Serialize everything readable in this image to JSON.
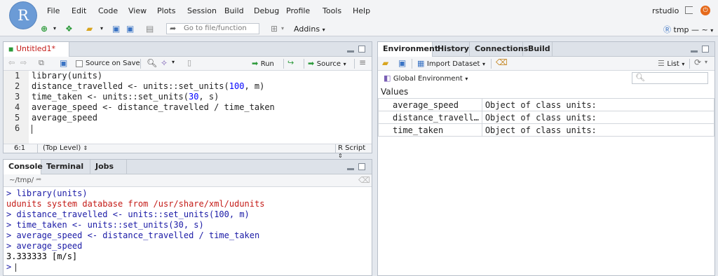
{
  "logo": {
    "letter": "R"
  },
  "menu": [
    "File",
    "Edit",
    "Code",
    "View",
    "Plots",
    "Session",
    "Build",
    "Debug",
    "Profile",
    "Tools",
    "Help"
  ],
  "user": "rstudio",
  "toolbar": {
    "goto_placeholder": "Go to file/function",
    "addins_label": "Addins",
    "project_label": "tmp — ~"
  },
  "editor": {
    "tab_label": "Untitled1*",
    "source_on_save_label": "Source on Save",
    "run_label": "Run",
    "source_label": "Source",
    "line_numbers": [
      "1",
      "2",
      "3",
      "4",
      "5",
      "6"
    ],
    "lines": [
      "library(units)",
      "distance_travelled <- units::set_units(100, m)",
      "time_taken <- units::set_units(30, s)",
      "average_speed <- distance_travelled / time_taken",
      "average_speed",
      ""
    ],
    "cursor_pos": "6:1",
    "scope": "(Top Level)",
    "file_type": "R Script"
  },
  "console": {
    "tabs": [
      "Console",
      "Terminal",
      "Jobs"
    ],
    "path": "~/tmp/",
    "lines": [
      {
        "text": "> library(units)",
        "kind": "input"
      },
      {
        "text": "udunits system database from /usr/share/xml/udunits",
        "kind": "message"
      },
      {
        "text": "> distance_travelled <- units::set_units(100, m)",
        "kind": "input"
      },
      {
        "text": "> time_taken <- units::set_units(30, s)",
        "kind": "input"
      },
      {
        "text": "> average_speed <- distance_travelled / time_taken",
        "kind": "input"
      },
      {
        "text": "> average_speed",
        "kind": "input"
      },
      {
        "text": "3.333333 [m/s]",
        "kind": "output"
      },
      {
        "text": ">",
        "kind": "input"
      }
    ]
  },
  "environment": {
    "tabs": [
      "Environment",
      "History",
      "Connections",
      "Build"
    ],
    "import_label": "Import Dataset",
    "list_label": "List",
    "scope_label": "Global Environment",
    "section_label": "Values",
    "rows": [
      {
        "name": "average_speed",
        "value": "Object of class units:"
      },
      {
        "name": "distance_travell…",
        "value": "Object of class units:"
      },
      {
        "name": "time_taken",
        "value": "Object of class units:"
      }
    ]
  },
  "colors": {
    "code_blue": "#1a1aa6",
    "number_blue": "#0000ff",
    "message_red": "#c41a16",
    "accent_green": "#2c9a3a",
    "power_orange": "#e56a1c"
  }
}
